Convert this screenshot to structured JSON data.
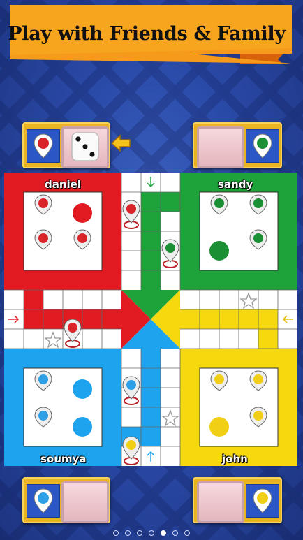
{
  "banner": {
    "title": "Play with  Friends & Family"
  },
  "players": {
    "top_left": {
      "name": "daniel",
      "color": "#e21b23"
    },
    "top_right": {
      "name": "sandy",
      "color": "#1ea23a"
    },
    "bottom_left": {
      "name": "soumya",
      "color": "#1ea4ef"
    },
    "bottom_right": {
      "name": "john",
      "color": "#f5d80d"
    }
  },
  "dice": {
    "value": 3,
    "current_turn": "daniel"
  },
  "board": {
    "start_arrows": [
      "right",
      "down",
      "left",
      "up"
    ],
    "token_colors": {
      "red": "#d9242a",
      "green": "#1a8f34",
      "blue": "#2f9fe6",
      "yellow": "#f2cf17"
    }
  },
  "pagination": {
    "total": 7,
    "active": 4
  },
  "icons": {
    "turn_indicator": "arrow-left-icon",
    "player_pin": "map-pin-icon",
    "safe_square": "star-icon"
  }
}
